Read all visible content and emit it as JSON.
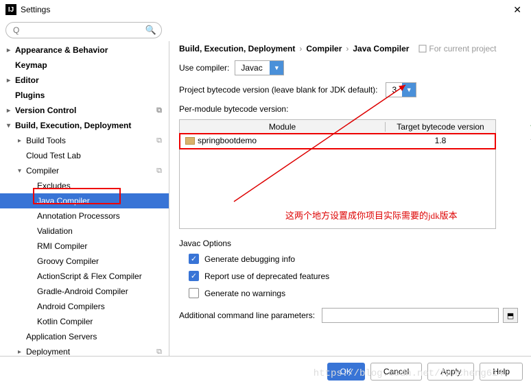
{
  "window": {
    "title": "Settings"
  },
  "search": {
    "placeholder": "Q"
  },
  "sidebar": {
    "items": [
      {
        "label": "Appearance & Behavior",
        "bold": true,
        "arrow": "▸",
        "lvl": 0
      },
      {
        "label": "Keymap",
        "bold": true,
        "arrow": "",
        "lvl": 0
      },
      {
        "label": "Editor",
        "bold": true,
        "arrow": "▸",
        "lvl": 0
      },
      {
        "label": "Plugins",
        "bold": true,
        "arrow": "",
        "lvl": 0
      },
      {
        "label": "Version Control",
        "bold": true,
        "arrow": "▸",
        "lvl": 0,
        "copy": true
      },
      {
        "label": "Build, Execution, Deployment",
        "bold": true,
        "arrow": "▾",
        "lvl": 0
      },
      {
        "label": "Build Tools",
        "bold": false,
        "arrow": "▸",
        "lvl": 1,
        "copy": true
      },
      {
        "label": "Cloud Test Lab",
        "bold": false,
        "arrow": "",
        "lvl": 1
      },
      {
        "label": "Compiler",
        "bold": false,
        "arrow": "▾",
        "lvl": 1,
        "copy": true
      },
      {
        "label": "Excludes",
        "bold": false,
        "arrow": "",
        "lvl": 2
      },
      {
        "label": "Java Compiler",
        "bold": false,
        "arrow": "",
        "lvl": 2,
        "selected": true
      },
      {
        "label": "Annotation Processors",
        "bold": false,
        "arrow": "",
        "lvl": 2
      },
      {
        "label": "Validation",
        "bold": false,
        "arrow": "",
        "lvl": 2
      },
      {
        "label": "RMI Compiler",
        "bold": false,
        "arrow": "",
        "lvl": 2
      },
      {
        "label": "Groovy Compiler",
        "bold": false,
        "arrow": "",
        "lvl": 2
      },
      {
        "label": "ActionScript & Flex Compiler",
        "bold": false,
        "arrow": "",
        "lvl": 2
      },
      {
        "label": "Gradle-Android Compiler",
        "bold": false,
        "arrow": "",
        "lvl": 2
      },
      {
        "label": "Android Compilers",
        "bold": false,
        "arrow": "",
        "lvl": 2
      },
      {
        "label": "Kotlin Compiler",
        "bold": false,
        "arrow": "",
        "lvl": 2
      },
      {
        "label": "Application Servers",
        "bold": false,
        "arrow": "",
        "lvl": 1
      },
      {
        "label": "Deployment",
        "bold": false,
        "arrow": "▸",
        "lvl": 1,
        "copy": true
      }
    ]
  },
  "breadcrumb": {
    "p1": "Build, Execution, Deployment",
    "p2": "Compiler",
    "p3": "Java Compiler",
    "scope": "For current project"
  },
  "compiler": {
    "use_label": "Use compiler:",
    "use_value": "Javac",
    "bytecode_label": "Project bytecode version (leave blank for JDK default):",
    "bytecode_value": "3",
    "per_module_label": "Per-module bytecode version:",
    "table": {
      "col1": "Module",
      "col2": "Target bytecode version",
      "rows": [
        {
          "module": "springbootdemo",
          "version": "1.8"
        }
      ]
    }
  },
  "annotation": "这两个地方设置成你项目实际需要的jdk版本",
  "javac": {
    "title": "Javac Options",
    "debug": "Generate debugging info",
    "deprecated": "Report use of deprecated features",
    "nowarn": "Generate no warnings",
    "params_label": "Additional command line parameters:",
    "params_value": ""
  },
  "footer": {
    "ok": "OK",
    "cancel": "Cancel",
    "apply": "Apply",
    "help": "Help"
  },
  "watermark": "https://blog.csdn.net/fancheng614"
}
